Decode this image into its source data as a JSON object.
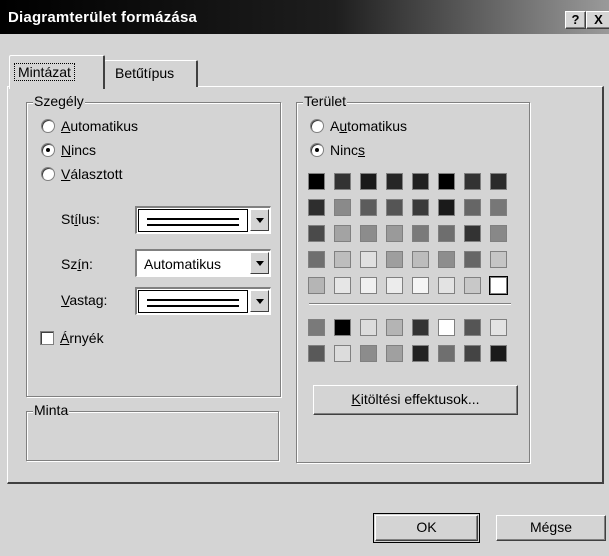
{
  "window": {
    "title": "Diagramterület formázása",
    "help_label": "?",
    "close_label": "X"
  },
  "tabs": [
    {
      "label": "Mintázat",
      "active": true
    },
    {
      "label": "Betűtípus",
      "active": false
    }
  ],
  "border_group": {
    "title": "Szegély",
    "options": [
      {
        "pre": "",
        "acc": "A",
        "post": "utomatikus",
        "checked": false
      },
      {
        "pre": "",
        "acc": "N",
        "post": "incs",
        "checked": true
      },
      {
        "pre": "",
        "acc": "V",
        "post": "álasztott",
        "checked": false
      }
    ],
    "style_label": {
      "pre": "St",
      "acc": "í",
      "post": "lus:"
    },
    "color_label": {
      "pre": "Sz",
      "acc": "í",
      "post": "n:"
    },
    "weight_label": {
      "pre": "",
      "acc": "V",
      "post": "astag:"
    },
    "color_value": "Automatikus",
    "shadow_label": {
      "pre": "",
      "acc": "Á",
      "post": "rnyék"
    },
    "shadow_checked": false
  },
  "sample_group": {
    "title": "Minta"
  },
  "area_group": {
    "title": "Terület",
    "options": [
      {
        "pre": "A",
        "acc": "u",
        "post": "tomatikus",
        "checked": false
      },
      {
        "pre": "Ninc",
        "acc": "s",
        "post": "",
        "checked": true
      }
    ],
    "palette_main": [
      [
        "#000000",
        "#333333",
        "#1a1a1a",
        "#262626",
        "#202020",
        "#000000",
        "#333333",
        "#2b2b2b"
      ],
      [
        "#2e2e2e",
        "#8a8a8a",
        "#5c5c5c",
        "#555555",
        "#3a3a3a",
        "#1a1a1a",
        "#666666",
        "#777777"
      ],
      [
        "#4a4a4a",
        "#a3a3a3",
        "#8c8c8c",
        "#9a9a9a",
        "#7a7a7a",
        "#6e6e6e",
        "#333333",
        "#888888"
      ],
      [
        "#6f6f6f",
        "#bdbdbd",
        "#e0e0e0",
        "#9e9e9e",
        "#bcbcbc",
        "#8d8d8d",
        "#666666",
        "#c5c5c5"
      ],
      [
        "#b5b5b5",
        "#e6e6e6",
        "#f0f0f0",
        "#ececec",
        "#f5f5f5",
        "#e3e3e3",
        "#c8c8c8",
        "#ffffff"
      ]
    ],
    "palette_extra": [
      [
        "#7a7a7a",
        "#000000",
        "#dcdcdc",
        "#b4b4b4",
        "#333333",
        "#ffffff",
        "#555555",
        "#e3e3e3"
      ],
      [
        "#595959",
        "#dcdcdc",
        "#8c8c8c",
        "#a0a0a0",
        "#222222",
        "#6f6f6f",
        "#444444",
        "#1a1a1a"
      ]
    ],
    "selected_swatch": "main-4-7",
    "fill_effects_label": {
      "pre": "",
      "acc": "K",
      "post": "itöltési effektusok..."
    }
  },
  "buttons": {
    "ok": "OK",
    "cancel": "Mégse"
  }
}
